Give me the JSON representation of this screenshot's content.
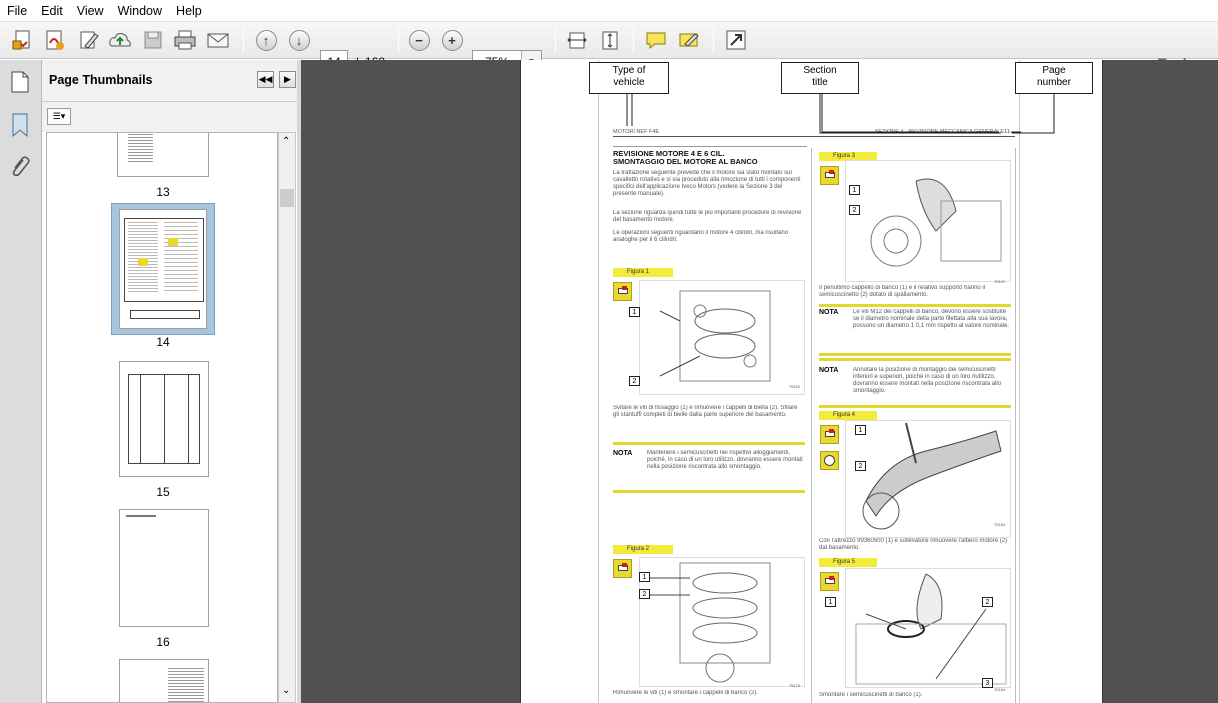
{
  "menu": [
    "File",
    "Edit",
    "View",
    "Window",
    "Help"
  ],
  "toolbar": {
    "page_current": "14",
    "page_sep": "/",
    "page_total": "168",
    "zoom": "75%",
    "tools_label": "Tools"
  },
  "panel": {
    "title": "Page Thumbnails"
  },
  "thumbnails": [
    {
      "label": "13"
    },
    {
      "label": "14"
    },
    {
      "label": "15"
    },
    {
      "label": "16"
    }
  ],
  "labels": {
    "type_of_vehicle": "Type of\nvehicle",
    "section_title": "Section\ntitle",
    "page_number": "Page\nnumber"
  },
  "doc": {
    "header_left": "MOTORI NEF F4E",
    "header_right": "SEZIONE 4 - REVISIONE MECCANICA GENERALE",
    "header_page": "11",
    "heading": "REVISIONE MOTORE 4 E 6 CIL.\nSMONTAGGIO DEL MOTORE AL BANCO",
    "para1": "La trattazione seguente prevede che il motore sia stato montato sul cavalletto rotativo e si sia proceduto alla rimozione di tutti i componenti specifici dell'applicazione Iveco Motors (vedere la Sezione 3 del presente manuale).",
    "para2": "La sezione riguarda quindi tutte le più importanti procedure di revisione del basamento motore.",
    "para3": "Le operazioni seguenti riguardano il motore 4 cilindri, ma risultano analoghe per il 6 cilindri.",
    "fig1": "Figura 1",
    "fig1_text": "Svitare le viti di fissaggio (1) e rimuovere i cappelli di biella (2). Sfilare gli stantuffi completi di bielle dalla parte superiore del basamento.",
    "nota_label": "NOTA",
    "nota1": "Mantenere i semicuscinetti nei rispettivi alloggiamenti, poiché, in caso di un loro utilizzo, dovranno essere montati nella posizione riscontrata allo smontaggio.",
    "fig2": "Figura 2",
    "fig2_text": "Rimuovere le viti (1) e smontare i cappelli di banco (2).",
    "fig3": "Figura 3",
    "fig3_text": "Il penultimo cappello di banco (1) e il relativo supporto hanno il semicuscinetto (2) dotato di spallamento.",
    "nota2": "Le viti M12 dei cappelli di banco, devono essere sostituite se il diametro nominale della parte filettata alla sua lavora, possono un diametro  1 0,1 mm rispetto al valore nominale.",
    "nota3": "Annotare la posizione di montaggio dei semicuscinetti inferiori e superiori, poiché in caso di un loro riutilizzo, dovranno essere montati nella posizione riscontrata allo smontaggio.",
    "fig4": "Figura 4",
    "fig4_text": "Con l'attrezzo 99360500 (1) e sollevatore rimuovere l'albero motore (2) dal basamento.",
    "fig5": "Figura 5",
    "fig5_text": "Smontare i semicuscinetti di banco (1).",
    "callouts": [
      "1",
      "2",
      "1",
      "2",
      "1",
      "2",
      "1",
      "2",
      "1",
      "2",
      "3"
    ],
    "codes": [
      "75192",
      "75179",
      "75197",
      "75183",
      "75184"
    ]
  }
}
